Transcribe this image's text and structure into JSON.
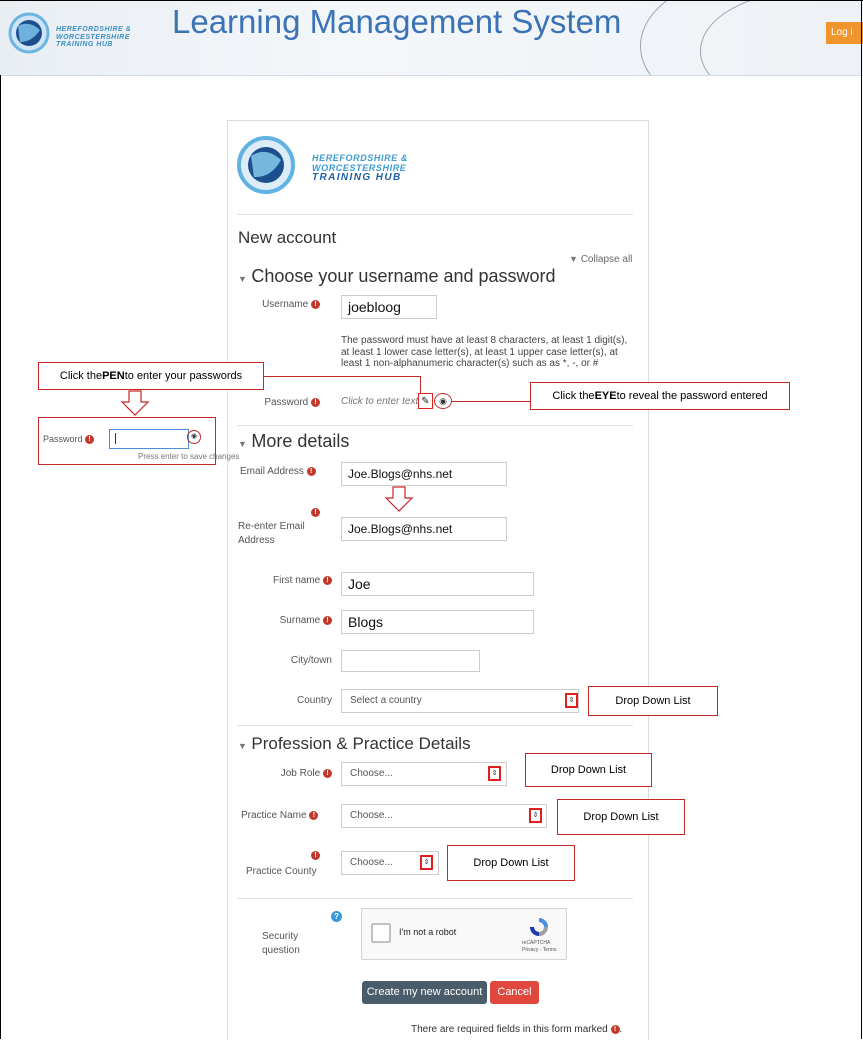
{
  "header": {
    "brand_small_line1": "HEREFORDSHIRE &",
    "brand_small_line2": "WORCESTERSHIRE",
    "brand_small_line3": "TRAINING HUB",
    "title": "Learning Management System",
    "login": "Log i"
  },
  "logo": {
    "line1": "HEREFORDSHIRE &",
    "line2": "WORCESTERSHIRE",
    "line3": "TRAINING HUB"
  },
  "form": {
    "heading": "New account",
    "collapse_all": "Collapse all",
    "section1": "Choose your username and password",
    "username_label": "Username",
    "username_value": "joebloog",
    "password_rules": [
      "The password must have at least 8 characters, at least 1 digit(s),",
      "at least 1 lower case letter(s), at least 1 upper case letter(s), at",
      "least 1 non-alphanumeric character(s) such as as *, -, or #"
    ],
    "password_label": "Password",
    "password_placeholder": "Click to enter text",
    "section2": "More details",
    "email_label": "Email Address",
    "email_value": "Joe.Blogs@nhs.net",
    "reemail_label_line1": "Re-enter Email",
    "reemail_label_line2": "Address",
    "reemail_value": "Joe.Blogs@nhs.net",
    "firstname_label": "First name",
    "firstname_value": "Joe",
    "surname_label": "Surname",
    "surname_value": "Blogs",
    "city_label": "City/town",
    "city_value": "",
    "country_label": "Country",
    "country_value": "Select a country",
    "section3": "Profession & Practice Details",
    "jobrole_label": "Job Role",
    "jobrole_value": "Choose...",
    "practicename_label": "Practice Name",
    "practicename_value": "Choose...",
    "practicecounty_label": "Practice County",
    "practicecounty_value": "Choose...",
    "security_label_line1": "Security",
    "security_label_line2": "question",
    "recaptcha_text": "I'm not a robot",
    "recaptcha_brand": "reCAPTCHA",
    "recaptcha_links": "Privacy - Terms",
    "create_button": "Create my new account",
    "cancel_button": "Cancel",
    "required_note": "There are required fields in this form marked"
  },
  "callouts": {
    "pen": "Click the PEN to enter your passwords",
    "pen_pre": "Click the ",
    "pen_bold": "PEN",
    "pen_post": " to enter your passwords",
    "eye_pre": "Click the ",
    "eye_bold": "EYE",
    "eye_post": " to reveal the password entered",
    "dropdown1": "Drop Down List",
    "dropdown2": "Drop Down List",
    "dropdown3": "Drop Down List",
    "dropdown4": "Drop Down List",
    "inset_password_label": "Password",
    "inset_hint": "Press enter to save changes"
  },
  "colors": {
    "title_blue": "#3b73b7",
    "login_orange": "#f0952b",
    "required_red": "#c0392b",
    "annotation_red": "#e02020",
    "primary_button": "#4a5b69",
    "cancel_button": "#e0483e"
  }
}
